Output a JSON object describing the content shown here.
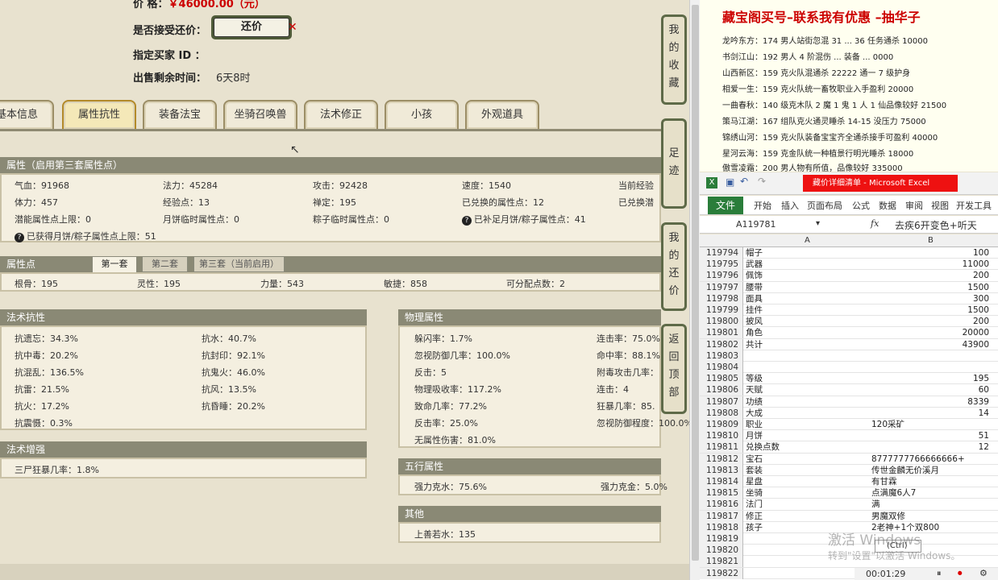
{
  "top": {
    "price_label": "价      格：",
    "price_value": "￥46000.00（元）",
    "accept_label": "是否接受还价：",
    "counter_button": "还价",
    "buyer_label": "指定买家 ID ：",
    "remain_label": "出售剩余时间：",
    "remain_value": "6天8时"
  },
  "tabs": [
    "基本信息",
    "属性抗性",
    "装备法宝",
    "坐骑召唤兽",
    "法术修正",
    "小孩",
    "外观道具"
  ],
  "active_tab": "属性抗性",
  "attr": {
    "header": "属性（启用第三套属性点）",
    "rows": [
      [
        "气血：91968",
        "法力：45284",
        "攻击：92428",
        "速度：1540",
        "当前经验"
      ],
      [
        "体力：457",
        "经验点：13",
        "禅定：195",
        "已兑换的属性点：12",
        "已兑换潜"
      ],
      [
        "潜能属性点上限：0",
        "月饼临时属性点：0",
        "粽子临时属性点：0",
        "已补足月饼/粽子属性点：41",
        ""
      ]
    ],
    "mooncake": "已获得月饼/粽子属性点上限：51"
  },
  "points": {
    "header": "属性点",
    "subtabs": [
      "第一套",
      "第二套",
      "第三套（当前启用）"
    ],
    "values": [
      "根骨：195",
      "灵性：195",
      "力量：543",
      "敏捷：858",
      "可分配点数：2"
    ]
  },
  "resist": {
    "header": "法术抗性",
    "left": [
      "抗遗忘：34.3%",
      "抗中毒：20.2%",
      "抗混乱：136.5%",
      "抗雷：21.5%",
      "抗火：17.2%",
      "抗震慑：0.3%"
    ],
    "right": [
      "抗水：40.7%",
      "抗封印：92.1%",
      "抗鬼火：46.0%",
      "抗风：13.5%",
      "抗昏睡：20.2%"
    ]
  },
  "enhance": {
    "header": "法术增强",
    "items": [
      "三尸狂暴几率：1.8%"
    ]
  },
  "physical": {
    "header": "物理属性",
    "left": [
      "躲闪率：1.7%",
      "忽视防御几率：100.0%",
      "反击：5",
      "物理吸收率：117.2%",
      "致命几率：77.2%",
      "反击率：25.0%",
      "无属性伤害：81.0%"
    ],
    "right": [
      "连击率：75.0%",
      "命中率：88.1%",
      "附毒攻击几率：",
      "连击：4",
      "狂暴几率：85.",
      "忽视防御程度：100.0%"
    ]
  },
  "five": {
    "header": "五行属性",
    "left": "强力克水：75.6%",
    "right": "强力克金：5.0%"
  },
  "other": {
    "header": "其他",
    "items": [
      "上善若水：135"
    ]
  },
  "side_buttons": [
    "我的收藏",
    "足迹",
    "我的还价",
    "返回顶部"
  ],
  "ad": {
    "title": "藏宝阁买号–联系我有优惠 –抽华子",
    "lines": [
      "龙吟东方：174 男人站街忽混 31 ... 36 任务通杀 10000",
      "书剑江山：192 男人 4 阶混伤 ... 装备 ... 0000",
      "山西新区：159 克火队混通杀 22222 通一 7 级护身",
      "相爱一生：159 克火队统一畜牧职业入手盈利 20000",
      "一曲春秋：140 级克木队 2 魔 1 鬼 1 人 1 仙品像较好 21500",
      "策马江湖：167 组队克火通灵睡杀 14-15 没压力 75000",
      "锦绣山河：159 克火队装备宝宝齐全通杀接手可盈利 40000",
      "星河云海：159 克金队统一种植景行明光睡杀 18000",
      "傲雪凌霜：200 男人物有所值，品像较好 335000"
    ]
  },
  "excel": {
    "title": "藏价详细清单 - Microsoft Excel",
    "ribbon": [
      "文件",
      "开始",
      "插入",
      "页面布局",
      "公式",
      "数据",
      "审阅",
      "视图",
      "开发工具"
    ],
    "namebox": "A119781",
    "fx": "fx",
    "formula": "去疾6开变色+听天",
    "col_a": "A",
    "col_b": "B",
    "rows": [
      [
        "119794",
        "帽子",
        "100"
      ],
      [
        "119795",
        "武器",
        "11000"
      ],
      [
        "119796",
        "佩饰",
        "200"
      ],
      [
        "119797",
        "腰带",
        "1500"
      ],
      [
        "119798",
        "面具",
        "300"
      ],
      [
        "119799",
        "挂件",
        "1500"
      ],
      [
        "119800",
        "披风",
        "200"
      ],
      [
        "119801",
        "角色",
        "20000"
      ],
      [
        "119802",
        "共计",
        "43900"
      ],
      [
        "119803",
        "",
        ""
      ],
      [
        "119804",
        "",
        ""
      ],
      [
        "119805",
        "等级",
        "195"
      ],
      [
        "119806",
        "天赋",
        "60"
      ],
      [
        "119807",
        "功绩",
        "8339"
      ],
      [
        "119808",
        "大成",
        "14"
      ],
      [
        "119809",
        "职业",
        "120采矿"
      ],
      [
        "119810",
        "月饼",
        "51"
      ],
      [
        "119811",
        "兑换点数",
        "12"
      ],
      [
        "119812",
        "宝石",
        "8777777766666666+"
      ],
      [
        "119813",
        "套装",
        "传世金麟无价溪月"
      ],
      [
        "119814",
        "星盘",
        "有甘霖"
      ],
      [
        "119815",
        "坐骑",
        "点满魔6人7"
      ],
      [
        "119816",
        "法门",
        "满"
      ],
      [
        "119817",
        "修正",
        "男魔双修"
      ],
      [
        "119818",
        "孩子",
        "2老神+1个双800"
      ],
      [
        "119819",
        "",
        ""
      ],
      [
        "119820",
        "",
        ""
      ],
      [
        "119821",
        "",
        ""
      ],
      [
        "119822",
        "",
        ""
      ]
    ],
    "ctrl_label": "(Ctrl)",
    "watermark1": "激活 Windows",
    "watermark2": "转到\"设置\"以激活 Windows。",
    "timer": "00:01:29"
  },
  "colors": {
    "price": "#cc0000",
    "panel_header": "#8a8975",
    "excel_green": "#2a7d3a",
    "ad_title": "#cc0000"
  }
}
